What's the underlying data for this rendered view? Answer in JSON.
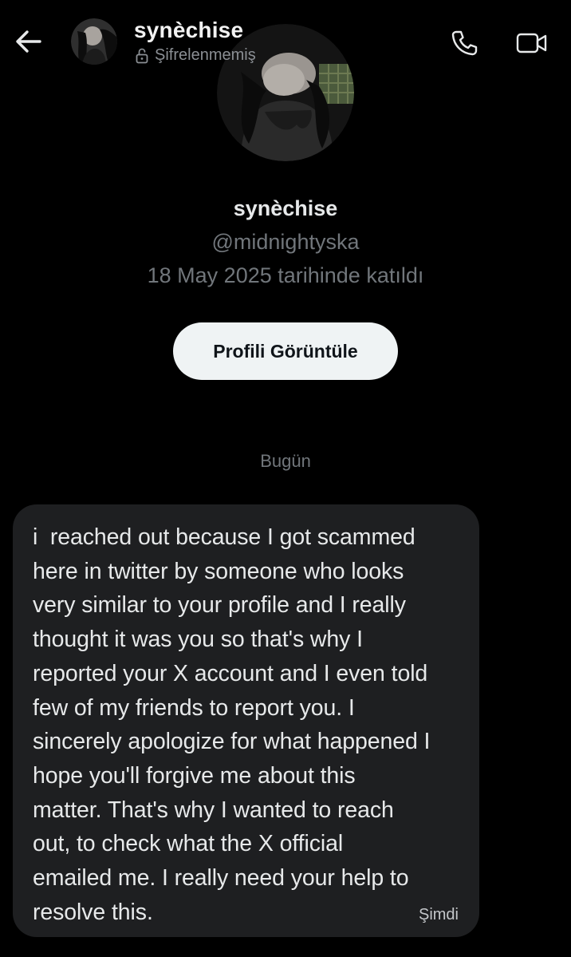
{
  "header": {
    "name": "synèchise",
    "encryption_status": "Şifrelenmemiş",
    "back_icon": "back-arrow-icon",
    "call_icon": "phone-icon",
    "video_icon": "video-camera-icon"
  },
  "profile": {
    "display_name": "synèchise",
    "handle": "@midnightyska",
    "joined": "18 May 2025 tarihinde katıldı",
    "view_profile_label": "Profili Görüntüle"
  },
  "conversation": {
    "date_divider": "Bugün",
    "messages": [
      {
        "text": "i  reached out because I got scammed\nhere in twitter by someone who looks\nvery similar to your profile and I really\nthought it was you so that's why I\nreported your X account and I even told\nfew of my friends to report you. I\nsincerely apologize for what happened I\nhope you'll forgive me about this\nmatter. That's why I wanted to reach\nout, to check what the X official\nemailed me. I really need your help to\nresolve this.",
        "time": "Şimdi"
      }
    ]
  },
  "colors": {
    "background": "#000000",
    "bubble": "#1e1f21",
    "primary_text": "#e7e9ea",
    "secondary_text": "#71767b",
    "button_bg": "#eff3f4",
    "button_text": "#0f1419"
  }
}
